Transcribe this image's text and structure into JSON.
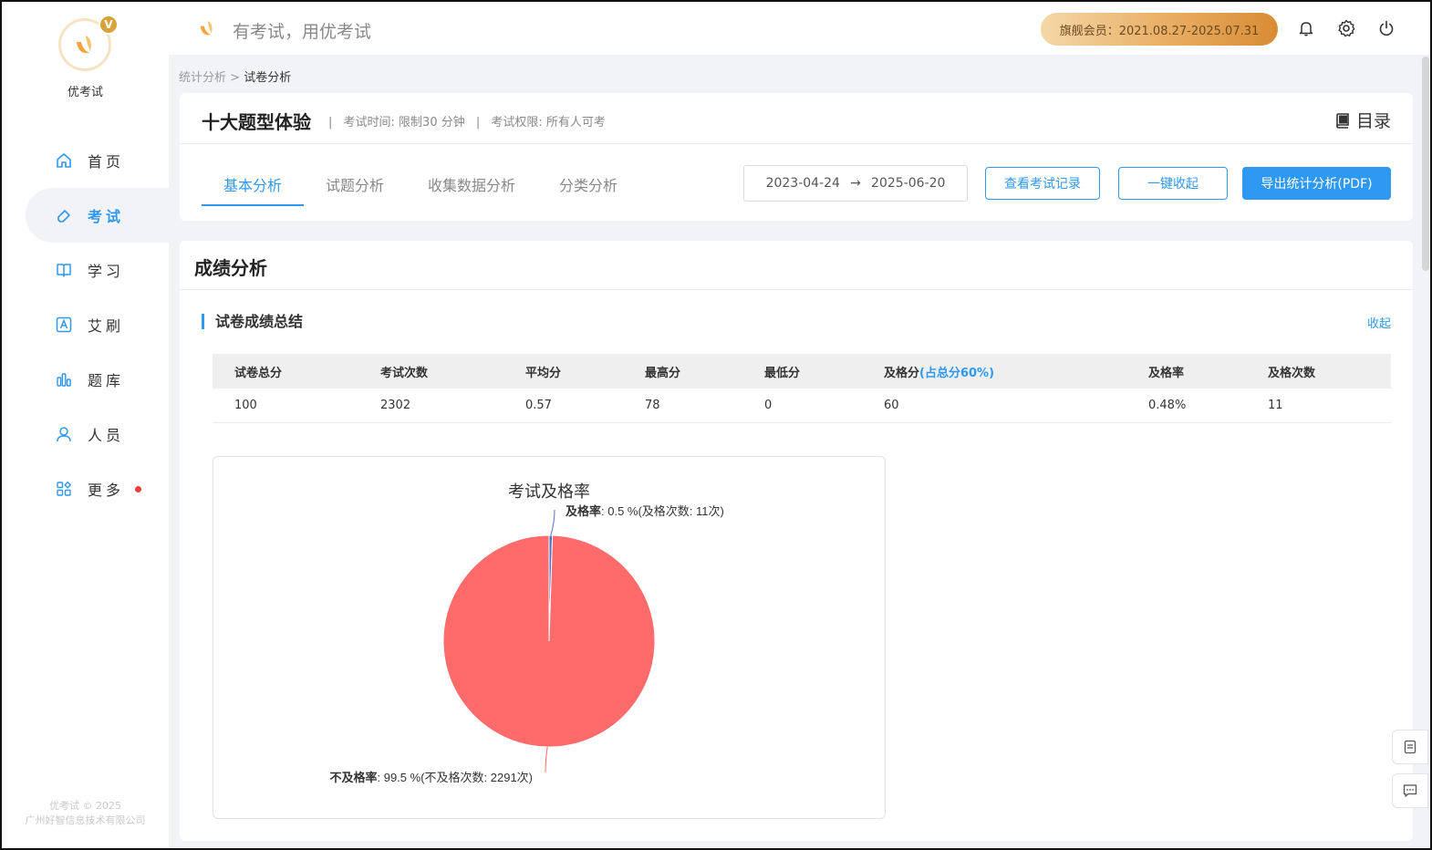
{
  "app": {
    "brand_name": "优考试",
    "slogan": "有考试，用优考试",
    "vip_mark": "V",
    "copyright_line1": "优考试 © 2025",
    "copyright_line2": "广州好智信息技术有限公司"
  },
  "topbar": {
    "member_text": "旗舰会员：2021.08.27-2025.07.31"
  },
  "sidebar": {
    "items": [
      {
        "label": "首页",
        "icon": "home-icon"
      },
      {
        "label": "考试",
        "icon": "eraser-icon",
        "active": true
      },
      {
        "label": "学习",
        "icon": "book-icon"
      },
      {
        "label": "艾刷",
        "icon": "a-letter-icon"
      },
      {
        "label": "题库",
        "icon": "bar-chart-icon"
      },
      {
        "label": "人员",
        "icon": "person-icon"
      },
      {
        "label": "更多",
        "icon": "apps-icon",
        "dot": true
      }
    ]
  },
  "breadcrumb": {
    "parent": "统计分析",
    "separator": ">",
    "current": "试卷分析"
  },
  "exam": {
    "title": "十大题型体验",
    "time_limit": "考试时间: 限制30 分钟",
    "permission": "考试权限: 所有人可考",
    "meta_sep": "|",
    "toc_label": "目录"
  },
  "tabs": [
    {
      "label": "基本分析",
      "active": true
    },
    {
      "label": "试题分析"
    },
    {
      "label": "收集数据分析"
    },
    {
      "label": "分类分析"
    }
  ],
  "date_range": {
    "start": "2023-04-24",
    "arrow": "→",
    "end": "2025-06-20"
  },
  "buttons": {
    "view_records": "查看考试记录",
    "collapse_all": "一键收起",
    "export_pdf": "导出统计分析(PDF)"
  },
  "section": {
    "title": "成绩分析",
    "sub_title": "试卷成绩总结",
    "collapse": "收起"
  },
  "table": {
    "headers": [
      "试卷总分",
      "考试次数",
      "平均分",
      "最高分",
      "最低分",
      "及格分",
      "及格率",
      "及格次数"
    ],
    "pass_hint": "(占总分60%)",
    "row": [
      "100",
      "2302",
      "0.57",
      "78",
      "0",
      "60",
      "0.48%",
      "11"
    ]
  },
  "chart_data": {
    "type": "pie",
    "title": "考试及格率",
    "slices": [
      {
        "name": "及格率",
        "value": 0.5,
        "count": 11,
        "label_name": "及格率",
        "label_value": ": 0.5 %(及格次数: 11次)",
        "color": "#5470c6"
      },
      {
        "name": "不及格率",
        "value": 99.5,
        "count": 2291,
        "label_name": "不及格率",
        "label_value": ": 99.5 %(不及格次数: 2291次)",
        "color": "#ff6a6a"
      }
    ]
  },
  "colors": {
    "primary": "#2f98f0",
    "fail": "#ff6a6a",
    "member_gold": "#e8ad62"
  }
}
